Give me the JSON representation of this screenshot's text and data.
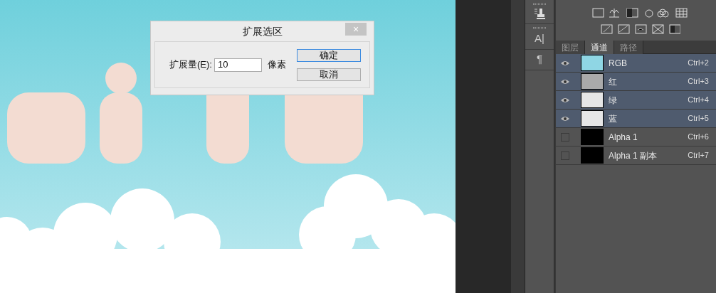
{
  "dialog": {
    "title": "扩展选区",
    "close": "×",
    "field_label": "扩展量(E):",
    "value": "10",
    "unit": "像素",
    "buttons": [
      {
        "label": "确定",
        "selected": true
      },
      {
        "label": "取消",
        "selected": false
      }
    ]
  },
  "tool_strip": [
    {
      "kind": "stamp"
    },
    {
      "kind": "type",
      "label": "A|"
    },
    {
      "kind": "paragraph",
      "label": "¶"
    }
  ],
  "panel_tabs": [
    {
      "label": "图层",
      "selected": false
    },
    {
      "label": "通道",
      "selected": true
    },
    {
      "label": "路径",
      "selected": false
    }
  ],
  "channels": [
    {
      "name": "RGB",
      "shortcut": "Ctrl+2",
      "visible": true,
      "selected": true,
      "kind": "color"
    },
    {
      "name": "红",
      "shortcut": "Ctrl+3",
      "visible": true,
      "selected": true,
      "kind": "gray"
    },
    {
      "name": "绿",
      "shortcut": "Ctrl+4",
      "visible": true,
      "selected": true,
      "kind": "light"
    },
    {
      "name": "蓝",
      "shortcut": "Ctrl+5",
      "visible": true,
      "selected": true,
      "kind": "light"
    },
    {
      "name": "Alpha 1",
      "shortcut": "Ctrl+6",
      "visible": false,
      "selected": false,
      "kind": "mask"
    },
    {
      "name": "Alpha 1 副本",
      "shortcut": "Ctrl+7",
      "visible": false,
      "selected": false,
      "kind": "mask"
    }
  ]
}
